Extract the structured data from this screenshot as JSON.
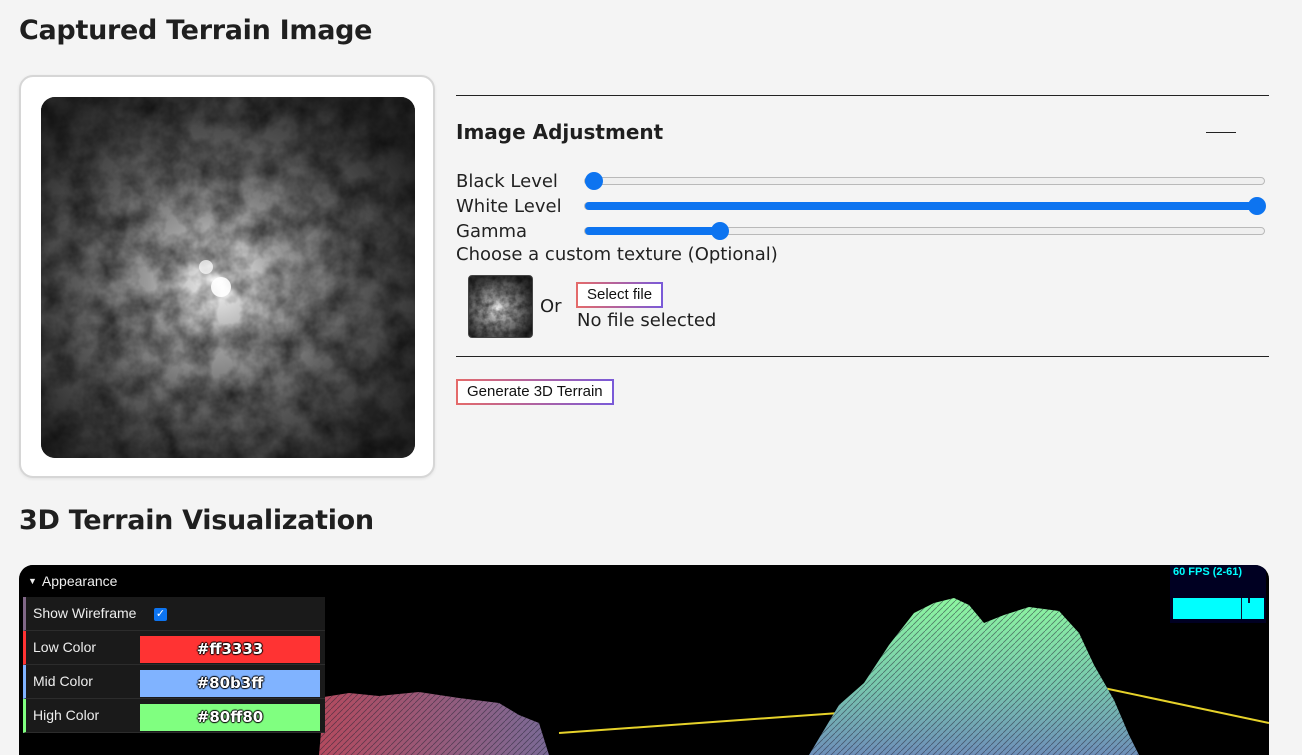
{
  "captured": {
    "title": "Captured Terrain Image"
  },
  "adjust": {
    "title": "Image Adjustment",
    "sliders": [
      {
        "label": "Black Level",
        "value": 0.0
      },
      {
        "label": "White Level",
        "value": 1.0
      },
      {
        "label": "Gamma",
        "value": 0.19
      }
    ],
    "texture_label": "Choose a custom texture (Optional)",
    "or_text": "Or",
    "select_file_label": "Select file",
    "no_file_text": "No file selected",
    "generate_label": "Generate 3D Terrain"
  },
  "viz": {
    "title": "3D Terrain Visualization",
    "gui": {
      "folder_label": "Appearance",
      "show_wireframe_label": "Show Wireframe",
      "show_wireframe_checked": true,
      "rows": [
        {
          "label": "Low Color",
          "value": "#ff3333"
        },
        {
          "label": "Mid Color",
          "value": "#80b3ff"
        },
        {
          "label": "High Color",
          "value": "#80ff80"
        }
      ]
    },
    "fps_text": "60 FPS (2-61)"
  },
  "colors": {
    "accent": "#0d74f0",
    "low": "#ff3333",
    "mid": "#80b3ff",
    "high": "#80ff80"
  },
  "icons": {
    "collapse": "minus-icon",
    "folder_arrow": "triangle-down-icon",
    "check": "checkmark-icon"
  }
}
